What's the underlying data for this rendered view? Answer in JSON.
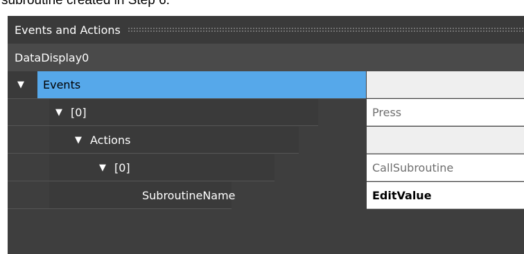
{
  "caption": "subroutine created in Step 6.",
  "window": {
    "title": "Events and Actions"
  },
  "object_name": "DataDisplay0",
  "tree": {
    "events": {
      "label": "Events",
      "value": ""
    },
    "event0": {
      "label": "[0]",
      "value": "Press"
    },
    "actions": {
      "label": "Actions",
      "value": ""
    },
    "action0": {
      "label": "[0]",
      "value": "CallSubroutine"
    },
    "subroutine_name": {
      "label": "SubroutineName",
      "value": "EditValue"
    }
  },
  "icons": {
    "expand": "▼"
  }
}
